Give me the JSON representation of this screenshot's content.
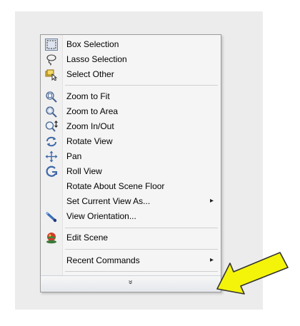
{
  "menu": {
    "items": [
      {
        "label": "Box Selection",
        "icon": "box-selection-icon"
      },
      {
        "label": "Lasso Selection",
        "icon": "lasso-icon"
      },
      {
        "label": "Select Other",
        "icon": "select-other-icon"
      },
      {
        "label": "Zoom to Fit",
        "icon": "zoom-to-fit-icon"
      },
      {
        "label": "Zoom to Area",
        "icon": "zoom-to-area-icon"
      },
      {
        "label": "Zoom In/Out",
        "icon": "zoom-in-out-icon"
      },
      {
        "label": "Rotate View",
        "icon": "rotate-view-icon"
      },
      {
        "label": "Pan",
        "icon": "pan-icon"
      },
      {
        "label": "Roll View",
        "icon": "roll-view-icon"
      },
      {
        "label": "Rotate About Scene Floor"
      },
      {
        "label": "Set Current View As...",
        "submenu": true
      },
      {
        "label": "View Orientation...",
        "icon": "view-orientation-icon"
      },
      {
        "label": "Edit Scene",
        "icon": "edit-scene-icon"
      },
      {
        "label": "Recent Commands",
        "submenu": true
      }
    ],
    "submenu_arrow": "▸",
    "expand_chevron": "»"
  },
  "colors": {
    "highlight_arrow": "#f4f40a",
    "menu_border": "#9c9c9c",
    "menu_background": "#f5f5f5"
  }
}
